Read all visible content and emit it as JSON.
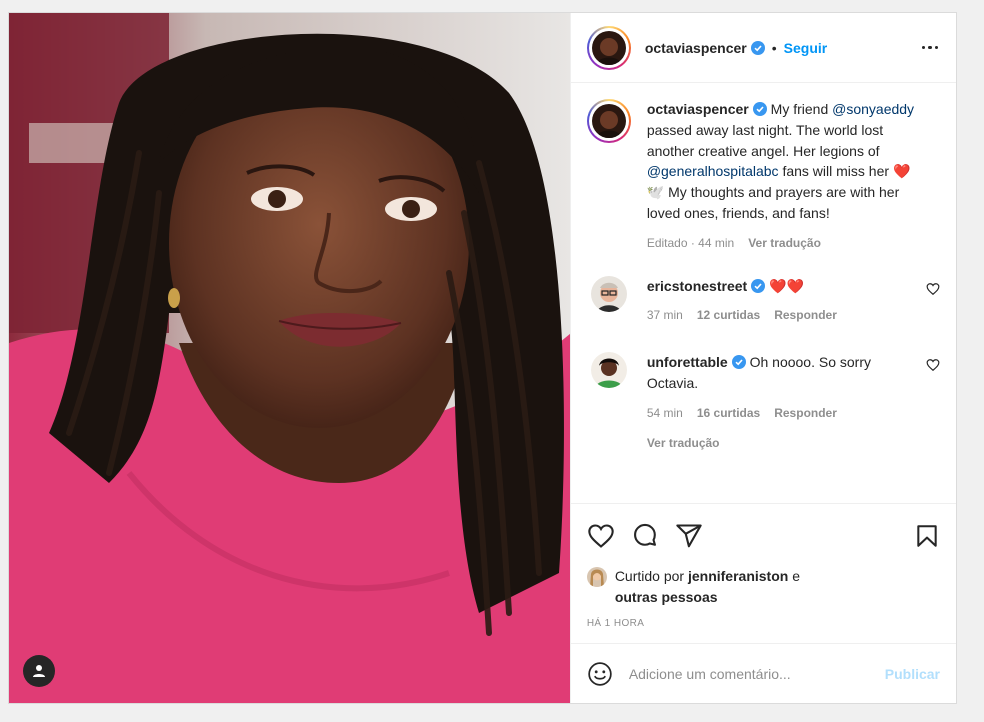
{
  "photo": {
    "tag_icon": "user-icon"
  },
  "header": {
    "username": "octaviaspencer",
    "separator": "•",
    "follow_label": "Seguir",
    "more_icon": "ellipsis-icon"
  },
  "caption": {
    "username": "octaviaspencer",
    "text_1": "My friend",
    "mention_1": "@sonyaeddy",
    "text_2": "passed away last night. The world lost another creative angel. Her legions of",
    "mention_2": "@generalhospitalabc",
    "text_3": "fans will miss her",
    "emojis": "❤️🕊️",
    "text_4": "My thoughts and prayers are with her loved ones, friends, and fans!",
    "edited": "Editado · 44 min",
    "see_translation": "Ver tradução"
  },
  "comments": [
    {
      "username": "ericstonestreet",
      "text": "❤️❤️",
      "time": "37 min",
      "likes": "12 curtidas",
      "reply": "Responder"
    },
    {
      "username": "unforettable",
      "text": "Oh noooo. So sorry Octavia.",
      "time": "54 min",
      "likes": "16 curtidas",
      "reply": "Responder",
      "see_translation": "Ver tradução"
    }
  ],
  "likes": {
    "prefix": "Curtido por",
    "user": "jenniferaniston",
    "conj": "e",
    "others": "outras pessoas"
  },
  "timestamp": "Há 1 hora",
  "add_comment": {
    "placeholder": "Adicione um comentário...",
    "publish_label": "Publicar"
  },
  "colors": {
    "accent": "#0095f6",
    "verified": "#3897f0",
    "publish_disabled": "#b2dffc",
    "shirt": "#e03c75"
  }
}
